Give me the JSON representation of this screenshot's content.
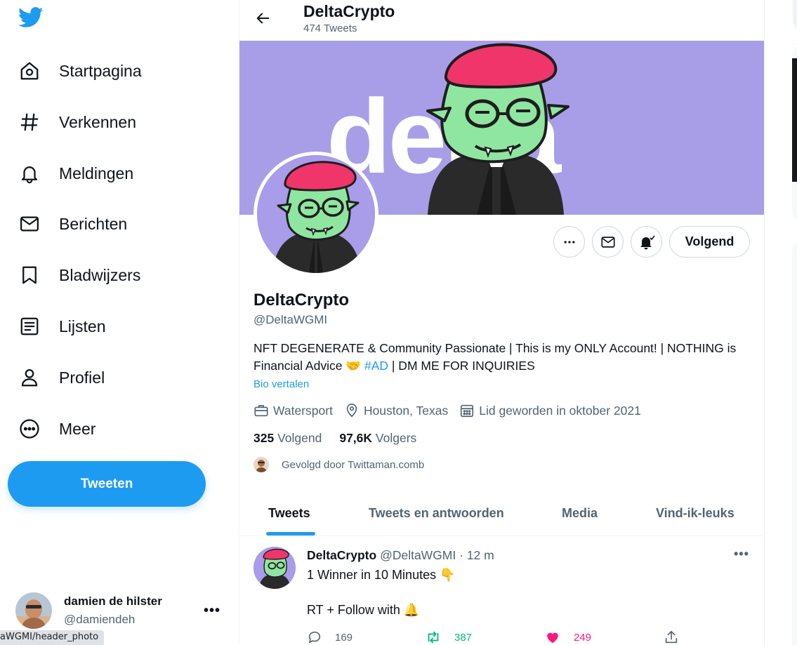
{
  "nav": {
    "items": [
      {
        "label": "Startpagina",
        "icon": "home-icon"
      },
      {
        "label": "Verkennen",
        "icon": "hashtag-icon"
      },
      {
        "label": "Meldingen",
        "icon": "bell-icon"
      },
      {
        "label": "Berichten",
        "icon": "envelope-icon"
      },
      {
        "label": "Bladwijzers",
        "icon": "bookmark-icon"
      },
      {
        "label": "Lijsten",
        "icon": "list-icon"
      },
      {
        "label": "Profiel",
        "icon": "person-icon"
      },
      {
        "label": "Meer",
        "icon": "more-circle-icon"
      }
    ],
    "tweet_button": "Tweeten"
  },
  "account": {
    "name": "damien de hilster",
    "handle": "@damiendeh"
  },
  "status_url": "aWGMI/header_photo",
  "header": {
    "title": "DeltaCrypto",
    "subtitle": "474 Tweets"
  },
  "banner": {
    "text": "delta",
    "color": "#a89ee8"
  },
  "profile": {
    "follow_label": "Volgend",
    "name": "DeltaCrypto",
    "handle": "@DeltaWGMI",
    "bio_part1": "NFT DEGENERATE & Community Passionate | This is my ONLY Account! | NOTHING is Financial Advice 🤝 ",
    "bio_tag": "#AD",
    "bio_part2": " | DM ME FOR INQUIRIES",
    "translate": "Bio vertalen",
    "category": "Watersport",
    "location": "Houston, Texas",
    "joined": "Lid geworden in oktober 2021",
    "following_count": "325",
    "following_label": "Volgend",
    "followers_count": "97,6K",
    "followers_label": "Volgers",
    "followed_by": "Gevolgd door Twittaman.comb"
  },
  "tabs": [
    "Tweets",
    "Tweets en antwoorden",
    "Media",
    "Vind-ik-leuks"
  ],
  "tweet": {
    "name": "DeltaCrypto",
    "handle": "@DeltaWGMI",
    "time": "· 12 m",
    "line1": "1 Winner in 10 Minutes 👇",
    "line2": "RT + Follow with 🔔",
    "replies": "169",
    "retweets": "387",
    "likes": "249"
  },
  "colors": {
    "accent": "#1d9bf0",
    "retweet": "#00ba7c",
    "like": "#f91880"
  }
}
